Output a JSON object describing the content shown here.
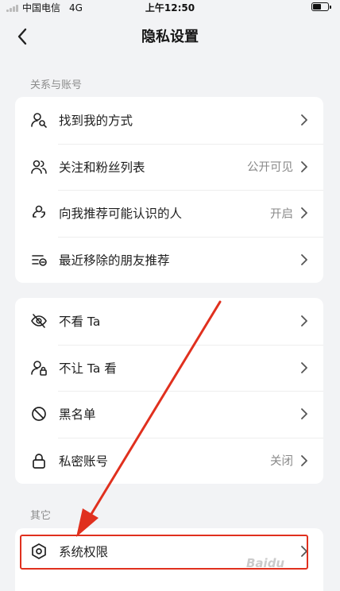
{
  "status_bar": {
    "carrier": "中国电信",
    "network": "4G",
    "time": "上午12:50"
  },
  "nav": {
    "title": "隐私设置",
    "back_icon": "chevron-left-icon"
  },
  "sections": [
    {
      "header": "关系与账号",
      "items": [
        {
          "label": "找到我的方式",
          "value": "",
          "icon": "person-search-icon"
        },
        {
          "label": "关注和粉丝列表",
          "value": "公开可见",
          "icon": "people-icon"
        },
        {
          "label": "向我推荐可能认识的人",
          "value": "开启",
          "icon": "person-link-icon"
        },
        {
          "label": "最近移除的朋友推荐",
          "value": "",
          "icon": "list-remove-icon"
        }
      ]
    },
    {
      "header": "",
      "items": [
        {
          "label": "不看 Ta",
          "value": "",
          "icon": "eye-off-icon"
        },
        {
          "label": "不让 Ta 看",
          "value": "",
          "icon": "person-lock-icon"
        },
        {
          "label": "黑名单",
          "value": "",
          "icon": "block-icon"
        },
        {
          "label": "私密账号",
          "value": "关闭",
          "icon": "lock-icon"
        }
      ]
    },
    {
      "header": "其它",
      "items": [
        {
          "label": "系统权限",
          "value": "",
          "icon": "hexagon-settings-icon"
        }
      ]
    }
  ],
  "annotation": {
    "color": "#e0301e"
  },
  "watermark": "Baidu"
}
